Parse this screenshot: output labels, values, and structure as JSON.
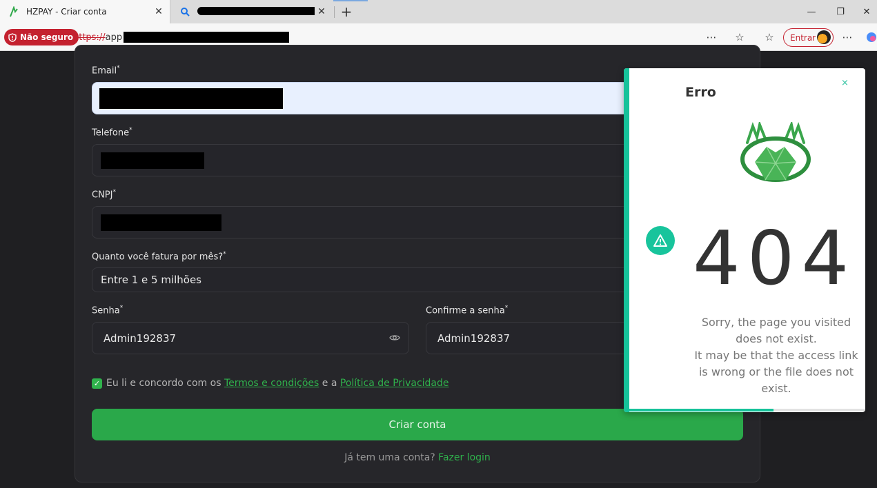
{
  "browser": {
    "active_tab_title": "HZPAY - Criar conta",
    "second_tab_title": "",
    "security_label": "Não seguro",
    "url_scheme": "https://",
    "url_visible": "app",
    "signin_label": "Entrar"
  },
  "form": {
    "email_label": "Email",
    "email_value": "",
    "phone_label": "Telefone",
    "phone_value": "",
    "cnpj_label": "CNPJ",
    "cnpj_value": "",
    "revenue_label": "Quanto você fatura por mês?",
    "revenue_value": "Entre 1 e 5 milhões",
    "password_label": "Senha",
    "password_value": "Admin192837",
    "confirm_label": "Confirme a senha",
    "confirm_value": "Admin192837",
    "required_mark": "*",
    "terms_prefix": "Eu li e concordo com os",
    "terms_link": "Termos e condições",
    "terms_mid": "e a",
    "privacy_link": "Política de Privacidade",
    "terms_checked": true,
    "submit_label": "Criar conta",
    "login_prompt": "Já tem uma conta?",
    "login_link": "Fazer login"
  },
  "error_popup": {
    "title": "Erro",
    "close_glyph": "×",
    "code": "404",
    "message_lines": [
      "Sorry, the page you visited",
      "does not exist.",
      "It may be that the access link",
      "is wrong or the file does not",
      "exist."
    ],
    "timer_progress": 0.61
  },
  "colors": {
    "accent_green": "#2aa84a",
    "popup_teal": "#16c29a",
    "danger_red": "#c4212f",
    "background": "#1f1f22"
  },
  "icons": {
    "tab_favicon": "hzpay-logo-icon",
    "search_tab": "search-icon",
    "not_secure": "shield-warning-icon",
    "password_toggle": "eye-icon",
    "warning": "warning-triangle-icon",
    "brand": "crown-leaf-logo-icon"
  }
}
